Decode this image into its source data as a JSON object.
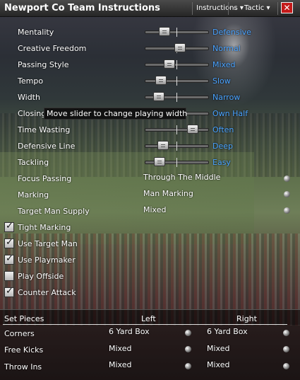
{
  "window": {
    "title": "Newport Co Team Instructions"
  },
  "toolbar": {
    "instructions_label": "Instructions ▾",
    "tactic_label": "Tactic ▾",
    "close_label": "✕"
  },
  "sliders": [
    {
      "label": "Mentality",
      "value": "Defensive",
      "level": 0.25
    },
    {
      "label": "Creative Freedom",
      "value": "Normal",
      "level": 0.55
    },
    {
      "label": "Passing Style",
      "value": "Mixed",
      "level": 0.35
    },
    {
      "label": "Tempo",
      "value": "Slow",
      "level": 0.18
    },
    {
      "label": "Width",
      "value": "Narrow",
      "level": 0.14
    },
    {
      "label": "Closing Down",
      "value": "Own Half",
      "level": 0.45
    },
    {
      "label": "Time Wasting",
      "value": "Often",
      "level": 0.78
    },
    {
      "label": "Defensive Line",
      "value": "Deep",
      "level": 0.22
    },
    {
      "label": "Tackling",
      "value": "Easy",
      "level": 0.16
    }
  ],
  "tooltip": "Move slider to change playing width",
  "dropdowns": [
    {
      "label": "Focus Passing",
      "value": "Through The Middle"
    },
    {
      "label": "Marking",
      "value": "Man Marking"
    },
    {
      "label": "Target Man Supply",
      "value": "Mixed"
    }
  ],
  "checkboxes": [
    {
      "label": "Tight Marking",
      "checked": true
    },
    {
      "label": "Use Target Man",
      "checked": true
    },
    {
      "label": "Use Playmaker",
      "checked": true
    },
    {
      "label": "Play Offside",
      "checked": false
    },
    {
      "label": "Counter Attack",
      "checked": true
    }
  ],
  "set_pieces": {
    "header": "Set Pieces",
    "left_header": "Left",
    "right_header": "Right",
    "rows": [
      {
        "label": "Corners",
        "left": "6 Yard Box",
        "right": "6 Yard Box"
      },
      {
        "label": "Free Kicks",
        "left": "Mixed",
        "right": "Mixed"
      },
      {
        "label": "Throw Ins",
        "left": "Mixed",
        "right": "Mixed"
      }
    ]
  }
}
